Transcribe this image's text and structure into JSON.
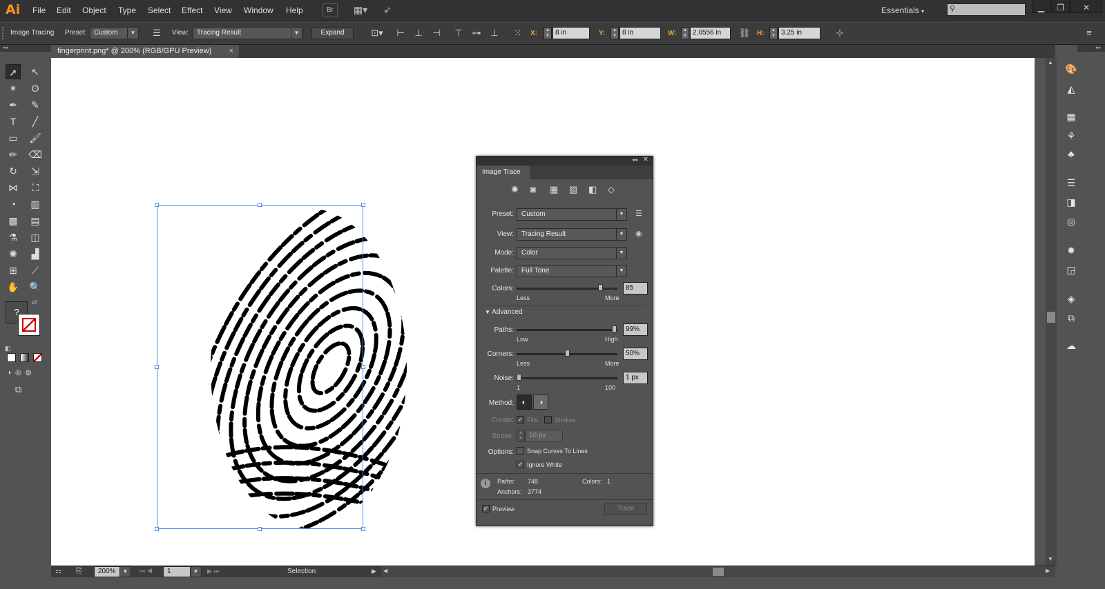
{
  "menubar": {
    "logo": "Ai",
    "items": [
      "File",
      "Edit",
      "Object",
      "Type",
      "Select",
      "Effect",
      "View",
      "Window",
      "Help"
    ],
    "bridge_label": "Br",
    "workspace": "Essentials",
    "search_placeholder": ""
  },
  "control_bar": {
    "context_label": "Image Tracing",
    "preset_label": "Preset:",
    "preset_value": "Custom",
    "view_label": "View:",
    "view_value": "Tracing Result",
    "expand_label": "Expand",
    "x_label": "X:",
    "x_value": "8 in",
    "y_label": "Y:",
    "y_value": "8 in",
    "w_label": "W:",
    "w_value": "2.0556 in",
    "h_label": "H:",
    "h_value": "3.25 in"
  },
  "document_tab": {
    "title": "fingerprint.png* @ 200% (RGB/GPU Preview)",
    "close": "×"
  },
  "status_bar": {
    "zoom": "200%",
    "artboard": "1",
    "tool": "Selection"
  },
  "image_trace_panel": {
    "title": "Image Trace",
    "preset_label": "Preset:",
    "preset_value": "Custom",
    "view_label": "View:",
    "view_value": "Tracing Result",
    "mode_label": "Mode:",
    "mode_value": "Color",
    "palette_label": "Palette:",
    "palette_value": "Full Tone",
    "colors_label": "Colors:",
    "colors_value": "85",
    "colors_level": 0.85,
    "colors_min": "Less",
    "colors_max": "More",
    "advanced_label": "Advanced",
    "paths_label": "Paths:",
    "paths_value": "99%",
    "paths_level": 0.99,
    "paths_min": "Low",
    "paths_max": "High",
    "corners_label": "Corners:",
    "corners_value": "50%",
    "corners_level": 0.5,
    "corners_min": "Less",
    "corners_max": "More",
    "noise_label": "Noise:",
    "noise_value": "1 px",
    "noise_level": 0.0,
    "noise_min": "1",
    "noise_max": "100",
    "method_label": "Method:",
    "create_label": "Create:",
    "fills_label": "Fills",
    "strokes_label": "Strokes",
    "stroke_label": "Stroke:",
    "stroke_value": "10 px",
    "options_label": "Options:",
    "snap_label": "Snap Curves To Lines",
    "ignore_white_label": "Ignore White",
    "stats_paths_label": "Paths:",
    "stats_paths_value": "748",
    "stats_colors_label": "Colors:",
    "stats_colors_value": "1",
    "stats_anchors_label": "Anchors:",
    "stats_anchors_value": "3774",
    "preview_label": "Preview",
    "trace_label": "Trace"
  },
  "colors": {
    "accent": "#4a8cf0",
    "logo": "#f7941e",
    "panel_bg": "#535353",
    "canvas": "#ffffff"
  }
}
